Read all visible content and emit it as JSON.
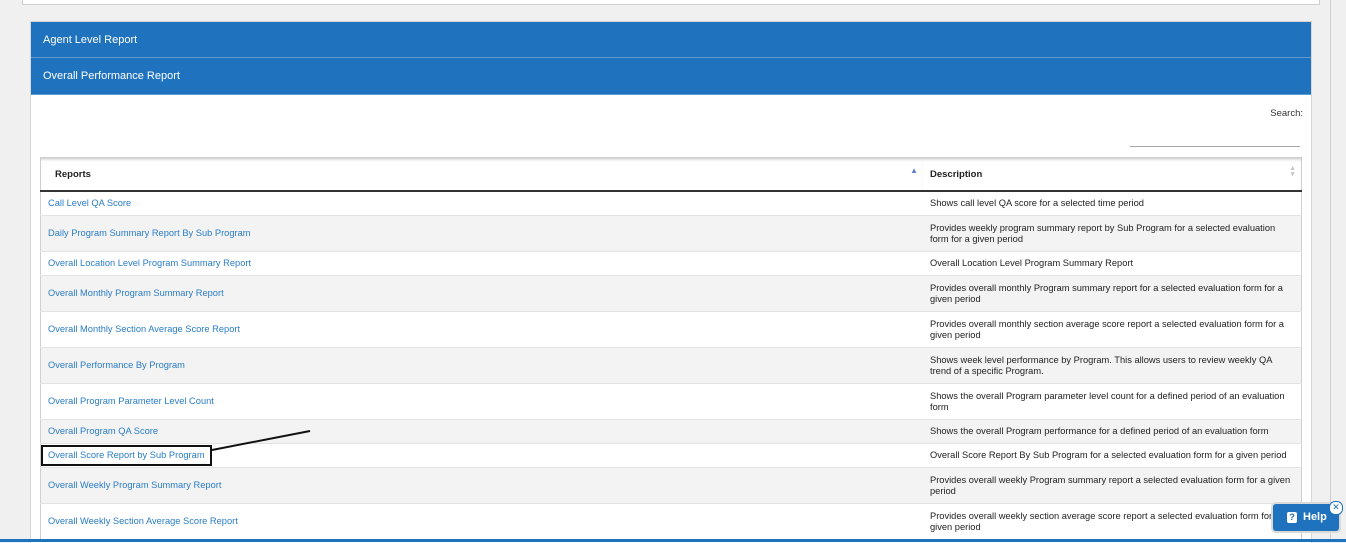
{
  "accordion": {
    "agent_level": "Agent Level Report",
    "overall_performance": "Overall Performance Report"
  },
  "search": {
    "label": "Search:",
    "value": ""
  },
  "table": {
    "headers": {
      "reports": "Reports",
      "description": "Description"
    },
    "rows": [
      {
        "name": "Call Level QA Score",
        "desc": "Shows call level QA score for a selected time period"
      },
      {
        "name": "Daily Program Summary Report By Sub Program",
        "desc": "Provides weekly program summary report by Sub Program for a selected evaluation form for a given period"
      },
      {
        "name": "Overall Location Level Program Summary Report",
        "desc": "Overall Location Level Program Summary Report"
      },
      {
        "name": "Overall Monthly Program Summary Report",
        "desc": "Provides overall monthly Program summary report for a selected evaluation form for a given period"
      },
      {
        "name": "Overall Monthly Section Average Score Report",
        "desc": "Provides overall monthly section average score report a selected evaluation form for a given period"
      },
      {
        "name": "Overall Performance By Program",
        "desc": "Shows week level performance by Program. This allows users to review weekly QA trend of a specific Program."
      },
      {
        "name": "Overall Program Parameter Level Count",
        "desc": "Shows the overall Program parameter level count for a defined period of an evaluation form"
      },
      {
        "name": "Overall Program QA Score",
        "desc": "Shows the overall Program performance for a defined period of an evaluation form"
      },
      {
        "name": "Overall Score Report by Sub Program",
        "desc": "Overall Score Report By Sub Program for a selected evaluation form for a given period"
      },
      {
        "name": "Overall Weekly Program Summary Report",
        "desc": "Provides overall weekly Program summary report a selected evaluation form for a given period"
      },
      {
        "name": "Overall Weekly Section Average Score Report",
        "desc": "Provides overall weekly section average score report a selected evaluation form for a given period"
      }
    ]
  },
  "help": {
    "label": "Help",
    "icon": "question-icon",
    "close_icon": "close-icon"
  }
}
